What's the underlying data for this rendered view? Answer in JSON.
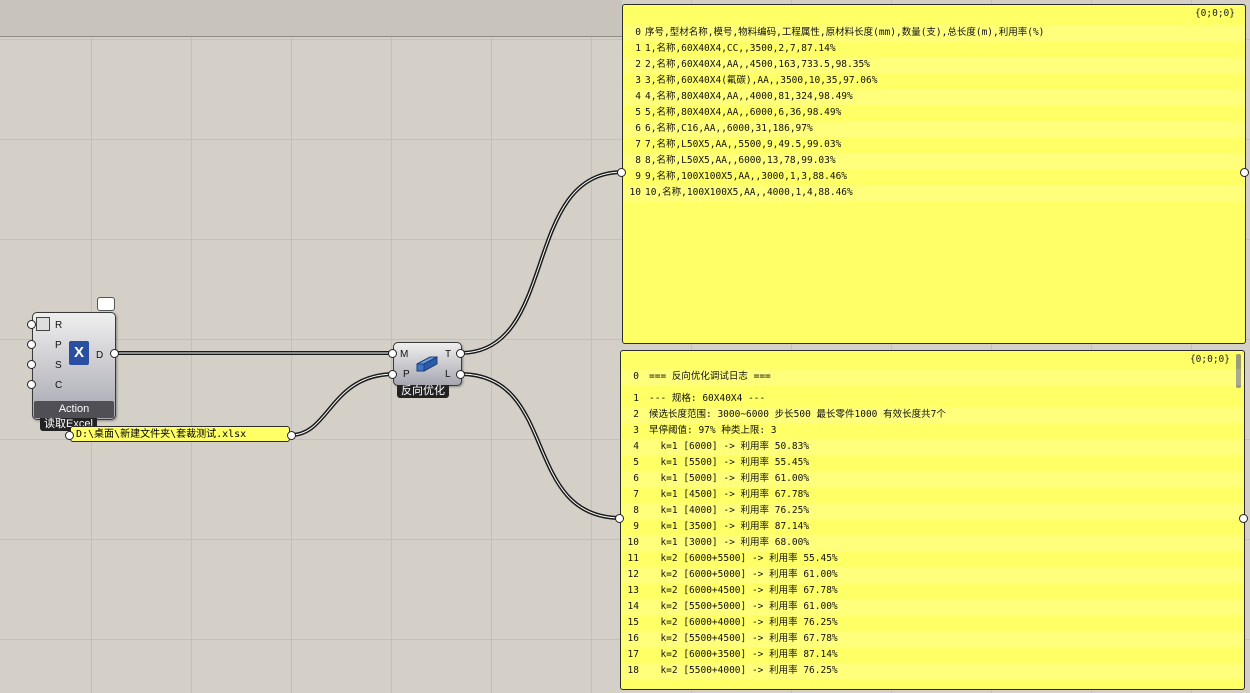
{
  "excel_component": {
    "inputs": [
      "R",
      "P",
      "S",
      "C"
    ],
    "output": "D",
    "action_label": "Action",
    "name_label": "读取Excel",
    "icon": "excel-x-icon"
  },
  "path_panel": {
    "value": "D:\\桌面\\新建文件夹\\套裁测试.xlsx"
  },
  "opt_component": {
    "inputs": [
      "M",
      "P"
    ],
    "outputs": [
      "T",
      "L"
    ],
    "name_label": "反向优化",
    "icon": "profile-bar-icon"
  },
  "panel_top": {
    "tag": "{0;0;0}",
    "rows": [
      {
        "i": "0",
        "t": "序号,型材名称,模号,物料编码,工程属性,原材料长度(mm),数量(支),总长度(m),利用率(%)"
      },
      {
        "i": "1",
        "t": "1,名称,60X40X4,CC,,3500,2,7,87.14%"
      },
      {
        "i": "2",
        "t": "2,名称,60X40X4,AA,,4500,163,733.5,98.35%"
      },
      {
        "i": "3",
        "t": "3,名称,60X40X4(氟碳),AA,,3500,10,35,97.06%"
      },
      {
        "i": "4",
        "t": "4,名称,80X40X4,AA,,4000,81,324,98.49%"
      },
      {
        "i": "5",
        "t": "5,名称,80X40X4,AA,,6000,6,36,98.49%"
      },
      {
        "i": "6",
        "t": "6,名称,C16,AA,,6000,31,186,97%"
      },
      {
        "i": "7",
        "t": "7,名称,L50X5,AA,,5500,9,49.5,99.03%"
      },
      {
        "i": "8",
        "t": "8,名称,L50X5,AA,,6000,13,78,99.03%"
      },
      {
        "i": "9",
        "t": "9,名称,100X100X5,AA,,3000,1,3,88.46%"
      },
      {
        "i": "10",
        "t": "10,名称,100X100X5,AA,,4000,1,4,88.46%"
      }
    ]
  },
  "panel_bottom": {
    "tag": "{0;0;0}",
    "rows": [
      {
        "i": "0",
        "t": "=== 反向优化调试日志 ==="
      },
      {
        "i": "1",
        "t": "--- 规格: 60X40X4 ---"
      },
      {
        "i": "2",
        "t": "候选长度范围: 3000~6000 步长500 最长零件1000 有效长度共7个"
      },
      {
        "i": "3",
        "t": "早停阈值: 97% 种类上限: 3"
      },
      {
        "i": "4",
        "t": "  k=1 [6000] -> 利用率 50.83%"
      },
      {
        "i": "5",
        "t": "  k=1 [5500] -> 利用率 55.45%"
      },
      {
        "i": "6",
        "t": "  k=1 [5000] -> 利用率 61.00%"
      },
      {
        "i": "7",
        "t": "  k=1 [4500] -> 利用率 67.78%"
      },
      {
        "i": "8",
        "t": "  k=1 [4000] -> 利用率 76.25%"
      },
      {
        "i": "9",
        "t": "  k=1 [3500] -> 利用率 87.14%"
      },
      {
        "i": "10",
        "t": "  k=1 [3000] -> 利用率 68.00%"
      },
      {
        "i": "11",
        "t": "  k=2 [6000+5500] -> 利用率 55.45%"
      },
      {
        "i": "12",
        "t": "  k=2 [6000+5000] -> 利用率 61.00%"
      },
      {
        "i": "13",
        "t": "  k=2 [6000+4500] -> 利用率 67.78%"
      },
      {
        "i": "14",
        "t": "  k=2 [5500+5000] -> 利用率 61.00%"
      },
      {
        "i": "15",
        "t": "  k=2 [6000+4000] -> 利用率 76.25%"
      },
      {
        "i": "16",
        "t": "  k=2 [5500+4500] -> 利用率 67.78%"
      },
      {
        "i": "17",
        "t": "  k=2 [6000+3500] -> 利用率 87.14%"
      },
      {
        "i": "18",
        "t": "  k=2 [5500+4000] -> 利用率 76.25%"
      }
    ]
  },
  "colors": {
    "canvas": "#d4d0c8",
    "panel": "#ffff66",
    "wire": "#1a1a1a"
  }
}
